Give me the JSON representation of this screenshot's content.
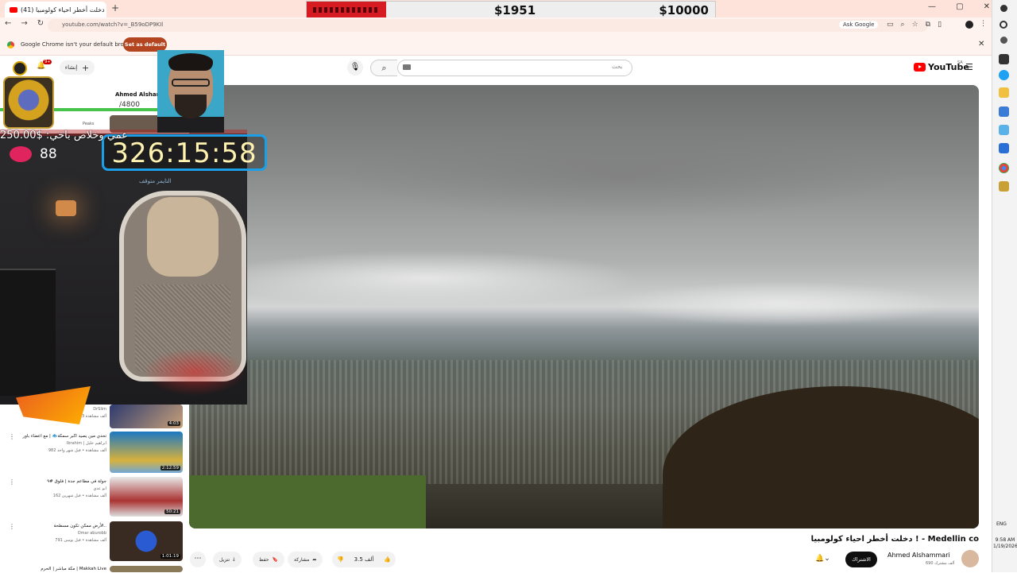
{
  "browser": {
    "tab_title": "(41) دخلت أخطر احياء كولومبيا !",
    "url": "youtube.com/watch?v=_B59oDP9KIl",
    "ask_google": "Ask Google",
    "infobar_text": "Google Chrome isn't your default browser",
    "infobar_button": "Set as default"
  },
  "goal_banner": {
    "current": "$1951",
    "target": "$10000",
    "accent": "#d61b22"
  },
  "youtube": {
    "logo_text": "YouTube",
    "region": "SA",
    "search_placeholder": "بحث",
    "create_label": "إنشاء",
    "notification_count": "9+",
    "video": {
      "title": "دخلت أخطر احياء كولومبيا ! - Medellin co",
      "channel": "Ahmed Alshammari",
      "subscribers": "690 ألف مشترك",
      "subscribe_label": "الاشتراك",
      "likes": "3.5 ألف",
      "share_label": "مشاركة",
      "save_label": "حفظ",
      "download_label": "تنزيل"
    },
    "recommended": [
      {
        "title": "Ahmed Alshammari",
        "meta": "",
        "duration": ""
      },
      {
        "title": "وصول البيت",
        "meta": "243 ألف مشاهدة",
        "channel": "DrSlim",
        "duration": "4:03"
      },
      {
        "title": "تحدي مين يصيد اكبر سمكة🐟 | مع اعضاء باور",
        "meta": "982 ألف مشاهدة • قبل شهر واحد",
        "channel": "Ibrahim | ابراهيم خليل",
        "duration": "2:12:59"
      },
      {
        "title": "جولة في مطاعم جدة | فلوق #٩",
        "meta": "162 ألف مشاهدة • قبل شهرين",
        "channel": "ابو عدي",
        "duration": "50:21"
      },
      {
        "title": "الأرض ممكن تكون مسطحة..",
        "meta": "791 ألف مشاهدة • قبل يومين",
        "channel": "Omar aburobb",
        "duration": "1:01:19"
      },
      {
        "title": "مكة مباشر | الحرم | Makkah Live",
        "meta": "",
        "channel": "",
        "duration": ""
      }
    ],
    "top_views": "/4800",
    "peaks_label": "Peaks"
  },
  "stream_overlay": {
    "timer": "326:15:58",
    "timer_sub": "التايمر متوقف",
    "donation": "250.00$ :عمي وخلاص باخي",
    "heart_rate": "88"
  },
  "system": {
    "language": "ENG",
    "time": "9:58 AM",
    "date": "1/19/2026"
  }
}
